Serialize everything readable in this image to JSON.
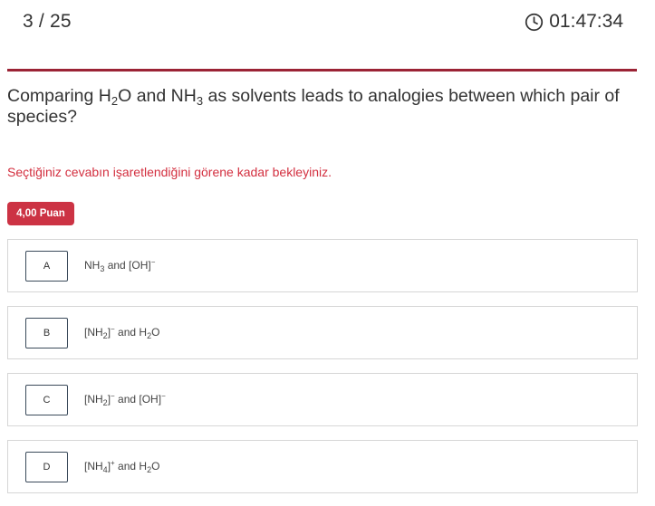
{
  "header": {
    "progress": "3 / 25",
    "timer": "01:47:34",
    "timer_icon": "clock-icon"
  },
  "colors": {
    "accent": "#9b2335",
    "warning_text": "#d32f3f",
    "badge_bg": "#cc3344"
  },
  "question": {
    "parts": [
      "Comparing H",
      "2",
      "O and NH",
      "3",
      " as solvents leads to analogies between which pair of species?"
    ]
  },
  "wait_message": "Seçtiğiniz cevabın işaretlendiğini görene kadar bekleyiniz.",
  "points": "4,00 Puan",
  "options": [
    {
      "letter": "A",
      "parts": [
        "NH",
        "3",
        " and [OH]",
        "−",
        ""
      ]
    },
    {
      "letter": "B",
      "parts": [
        "[NH",
        "2",
        "]",
        "−",
        " and H",
        "2",
        "O"
      ]
    },
    {
      "letter": "C",
      "parts": [
        "[NH",
        "2",
        "]",
        "−",
        " and [OH]",
        "−",
        ""
      ]
    },
    {
      "letter": "D",
      "parts": [
        "[NH",
        "4",
        "]",
        "+",
        " and H",
        "2",
        "O"
      ]
    }
  ]
}
